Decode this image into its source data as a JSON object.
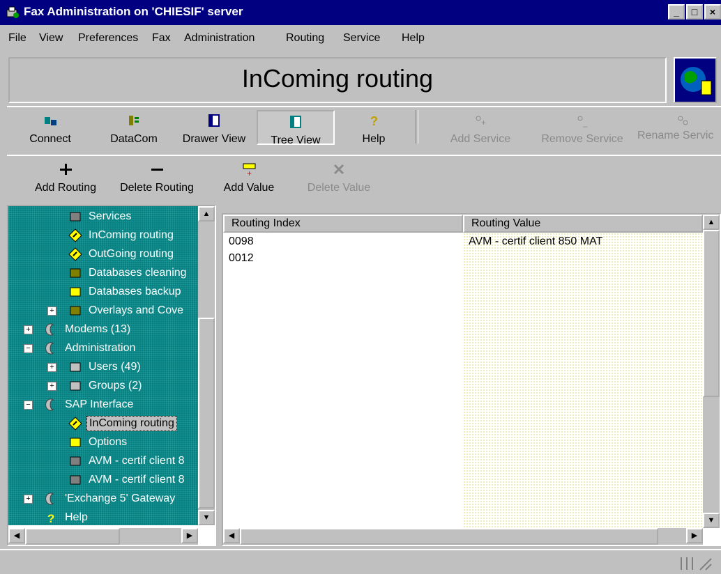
{
  "window": {
    "title": "Fax Administration on 'CHIESIF' server",
    "minimize": "_",
    "maximize": "□",
    "close": "×"
  },
  "menu": [
    "File",
    "View",
    "Preferences",
    "Fax",
    "Administration",
    "Routing",
    "Service",
    "Help"
  ],
  "banner": {
    "title": "InComing routing"
  },
  "toolbar": {
    "connect": "Connect",
    "datacom": "DataCom",
    "drawer_view": "Drawer View",
    "tree_view": "Tree View",
    "help": "Help",
    "add_service": "Add Service",
    "remove_service": "Remove Service",
    "rename_service": "Rename Servic"
  },
  "toolbar2": {
    "add_routing": "Add Routing",
    "delete_routing": "Delete Routing",
    "add_value": "Add Value",
    "delete_value": "Delete Value"
  },
  "tree": [
    {
      "label": "Services",
      "icon": "services-icon"
    },
    {
      "label": "InComing routing",
      "icon": "routing-diamond-icon"
    },
    {
      "label": "OutGoing routing",
      "icon": "routing-diamond-icon"
    },
    {
      "label": "Databases cleaning",
      "icon": "cleaning-icon"
    },
    {
      "label": "Databases backup",
      "icon": "backup-icon"
    },
    {
      "label": "Overlays and Cove",
      "icon": "overlays-icon"
    },
    {
      "label": "Modems (13)",
      "icon": "node-icon"
    },
    {
      "label": "Administration",
      "icon": "node-icon"
    },
    {
      "label": "Users (49)",
      "icon": "users-icon"
    },
    {
      "label": "Groups (2)",
      "icon": "groups-icon"
    },
    {
      "label": "SAP Interface",
      "icon": "node-icon"
    },
    {
      "label": "InComing routing",
      "icon": "routing-diamond-icon",
      "selected": true
    },
    {
      "label": "Options",
      "icon": "options-icon"
    },
    {
      "label": "AVM - certif client 8",
      "icon": "services-icon"
    },
    {
      "label": "AVM - certif client 8",
      "icon": "services-icon"
    },
    {
      "label": "'Exchange 5' Gateway",
      "icon": "node-icon"
    },
    {
      "label": "Help",
      "icon": "help-icon"
    }
  ],
  "list": {
    "columns": [
      "Routing Index",
      "Routing Value"
    ],
    "rows": [
      {
        "index": "0098",
        "value": "AVM - certif client 850 MAT"
      },
      {
        "index": "0012",
        "value": ""
      }
    ]
  },
  "colors": {
    "title_bar": "#000080",
    "tree_bg": "#0a7f7f",
    "chrome": "#c0c0c0"
  }
}
